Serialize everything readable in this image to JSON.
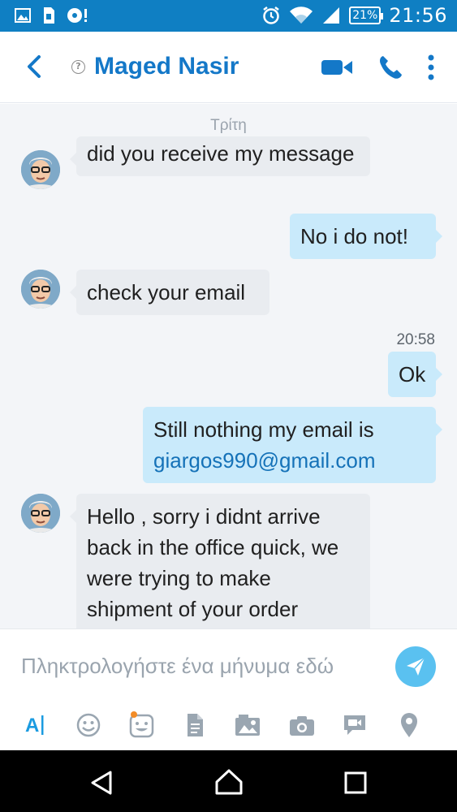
{
  "status_bar": {
    "battery": "21%",
    "time": "21:56"
  },
  "header": {
    "contact_name": "Maged Nasir",
    "icons": [
      "back-arrow-icon",
      "presence-unknown-icon",
      "video-call-icon",
      "voice-call-icon",
      "more-vertical-icon"
    ]
  },
  "chat": {
    "day_label": "Τρίτη",
    "messages": [
      {
        "direction": "incoming",
        "text": "did you receive my message"
      },
      {
        "direction": "outgoing",
        "text": "No i do not!"
      },
      {
        "direction": "incoming",
        "text": "check your email"
      },
      {
        "direction": "outgoing",
        "time": "20:58",
        "text": "Ok"
      },
      {
        "direction": "outgoing",
        "text": "Still nothing my email is",
        "link": "giargos990@gmail.com"
      },
      {
        "direction": "incoming",
        "text": "Hello , sorry i didnt arrive back in the office quick, we were trying to make shipment of your order"
      }
    ]
  },
  "composer": {
    "placeholder": "Πληκτρολογήστε ένα μήνυμα εδώ",
    "toolbar_icons": [
      "text-format-icon",
      "emoticon-icon",
      "moji-icon",
      "file-icon",
      "media-icon",
      "camera-icon",
      "video-message-icon",
      "location-icon"
    ]
  },
  "colors": {
    "brand": "#0f7fc3",
    "accent": "#1478c8",
    "outgoing_bubble": "#c9eafb",
    "incoming_bubble": "#e9ecf0",
    "send_button": "#5ac1f0"
  },
  "nav_bar": {
    "icons": [
      "back-triangle-icon",
      "home-icon",
      "recents-icon"
    ]
  }
}
